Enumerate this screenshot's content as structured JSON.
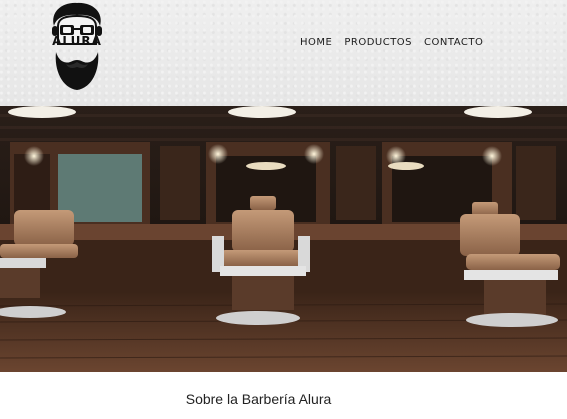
{
  "brand": {
    "logo_text": "ALURA",
    "logo_icon": "bearded-man-with-glasses-icon"
  },
  "nav": {
    "items": [
      "HOME",
      "PRODUCTOS",
      "CONTACTO"
    ]
  },
  "banner": {
    "image": "barbershop-interior-photo"
  },
  "about": {
    "title": "Sobre la Barbería Alura"
  }
}
